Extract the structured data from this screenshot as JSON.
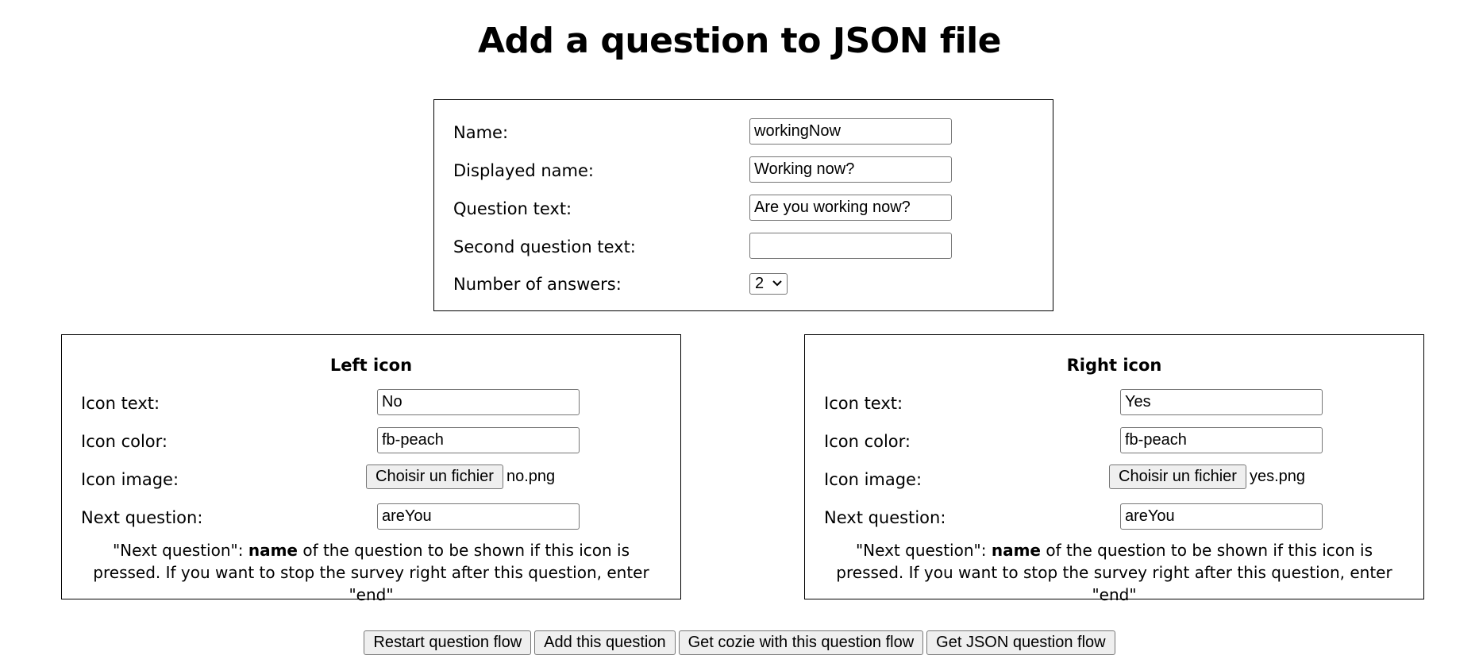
{
  "title": "Add a question to JSON file",
  "general": {
    "name_label": "Name:",
    "name_value": "workingNow",
    "displayed_name_label": "Displayed name:",
    "displayed_name_value": "Working now?",
    "question_text_label": "Question text:",
    "question_text_value": "Are you working now?",
    "second_question_label": "Second question text:",
    "second_question_value": "",
    "answers_label": "Number of answers:",
    "answers_value": "2"
  },
  "left_icon": {
    "title": "Left icon",
    "text_label": "Icon text:",
    "text_value": "No",
    "color_label": "Icon color:",
    "color_value": "fb-peach",
    "image_label": "Icon image:",
    "file_button": "Choisir un fichier",
    "file_name": "no.png",
    "next_label": "Next question:",
    "next_value": "areYou",
    "help_prefix": "\"Next question\": ",
    "help_bold": "name",
    "help_suffix": " of the question to be shown if this icon is pressed. If you want to stop the survey right after this question, enter \"end\""
  },
  "right_icon": {
    "title": "Right icon",
    "text_label": "Icon text:",
    "text_value": "Yes",
    "color_label": "Icon color:",
    "color_value": "fb-peach",
    "image_label": "Icon image:",
    "file_button": "Choisir un fichier",
    "file_name": "yes.png",
    "next_label": "Next question:",
    "next_value": "areYou",
    "help_prefix": "\"Next question\": ",
    "help_bold": "name",
    "help_suffix": " of the question to be shown if this icon is pressed. If you want to stop the survey right after this question, enter \"end\""
  },
  "actions": {
    "restart": "Restart question flow",
    "add": "Add this question",
    "get_cozie": "Get cozie with this question flow",
    "get_json": "Get JSON question flow"
  }
}
